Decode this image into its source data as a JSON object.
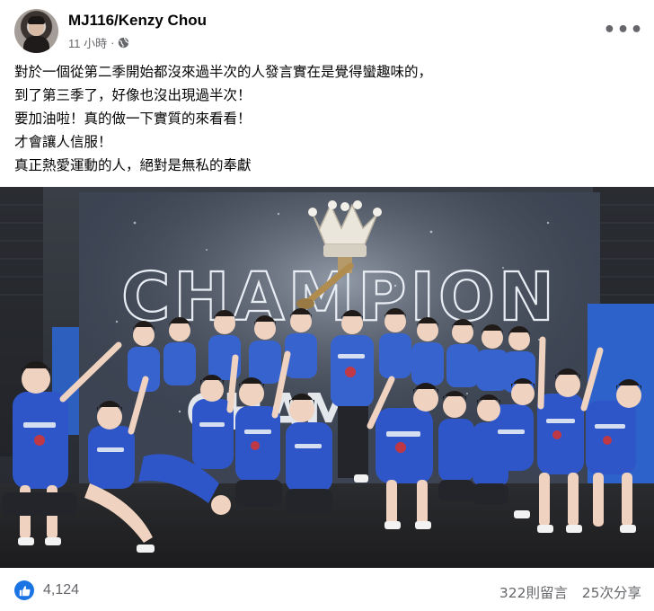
{
  "post": {
    "author": "MJ116/Kenzy Chou",
    "timestamp": "11 小時",
    "separator": "·",
    "privacy_icon": "globe-icon",
    "more_icon": "more-options-icon",
    "more_label": "•••",
    "text_lines": [
      "對於一個從第二季開始都沒來過半次的人發言實在是覺得蠻趣味的，",
      "到了第三季了，好像也沒出現過半次！",
      "要加油啦！真的做一下實質的來看看！",
      "才會讓人信服！",
      "真正熱愛運動的人，絕對是無私的奉獻"
    ],
    "image": {
      "backdrop_text": "CHAMPION",
      "description_icon": "team-trophy-photo"
    }
  },
  "footer": {
    "like_icon": "thumbs-up-icon",
    "like_count": "4,124",
    "comments": "322則留言",
    "shares": "25次分享"
  },
  "colors": {
    "accent": "#1b74e4",
    "muted_text": "#65676b",
    "jersey_blue": "#2f56c8"
  }
}
